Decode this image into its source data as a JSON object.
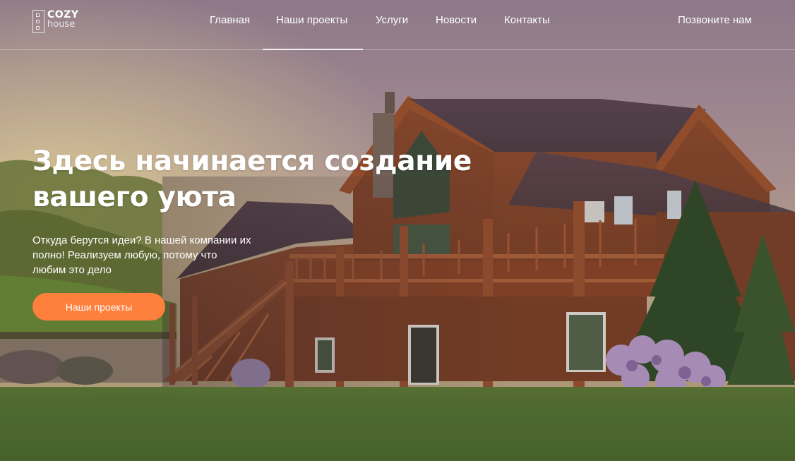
{
  "header": {
    "logo": {
      "line1": "COZY",
      "line2": "house"
    },
    "nav": [
      {
        "label": "Главная"
      },
      {
        "label": "Наши проекты",
        "active": true
      },
      {
        "label": "Услуги"
      },
      {
        "label": "Новости"
      },
      {
        "label": "Контакты"
      }
    ],
    "call_link": "Позвоните нам"
  },
  "hero": {
    "title_line1": "Здесь начинается создание",
    "title_line2": "вашего уюта",
    "text_line1": "Откуда берутся идеи? В нашей компании их",
    "text_line2": "полно! Реализуем любую, потому что",
    "text_line3": "любим это дело",
    "button_label": "Наши проекты"
  },
  "colors": {
    "accent": "#ff7f3c",
    "sky_top": "#a58f9e",
    "sky_bottom": "#cbb08e",
    "wood": "#8a4a2c",
    "grass": "#4c6b2e"
  },
  "background": {
    "icon": "log-house-photo"
  }
}
